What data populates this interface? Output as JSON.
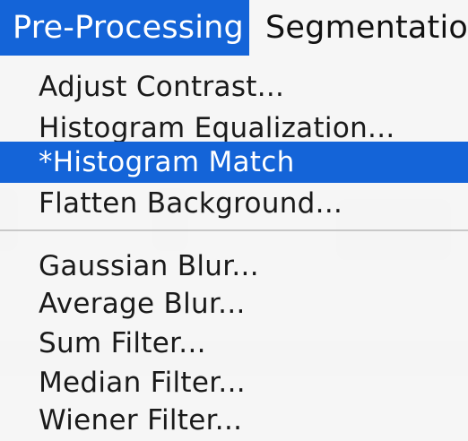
{
  "menubar": {
    "items": [
      {
        "label": "Pre-Processing",
        "active": true
      },
      {
        "label": "Segmentation",
        "active": false
      }
    ]
  },
  "dropdown": {
    "groups": [
      {
        "items": [
          {
            "label": "Adjust Contrast...",
            "highlighted": false
          },
          {
            "label": "Histogram Equalization...",
            "highlighted": false
          },
          {
            "label": "*Histogram Match",
            "highlighted": true
          },
          {
            "label": "Flatten Background...",
            "highlighted": false
          }
        ]
      },
      {
        "items": [
          {
            "label": "Gaussian Blur...",
            "highlighted": false
          },
          {
            "label": "Average Blur...",
            "highlighted": false
          },
          {
            "label": "Sum Filter...",
            "highlighted": false
          },
          {
            "label": "Median Filter...",
            "highlighted": false
          },
          {
            "label": "Wiener Filter...",
            "highlighted": false
          }
        ]
      }
    ]
  },
  "colors": {
    "highlight": "#1464d8",
    "highlight_text": "#ffffff",
    "text": "#1a1a1a",
    "menu_background": "#f6f6f6",
    "separator": "#c9c9c9"
  }
}
